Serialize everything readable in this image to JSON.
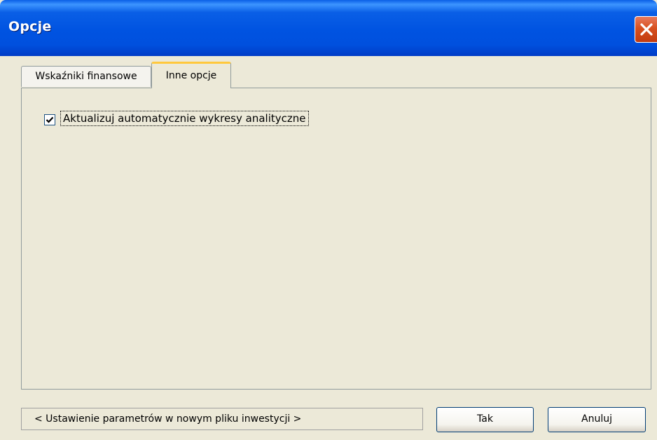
{
  "window": {
    "title": "Opcje"
  },
  "tabs": [
    {
      "label": "Wskaźniki finansowe",
      "selected": false
    },
    {
      "label": "Inne opcje",
      "selected": true
    }
  ],
  "options": {
    "auto_update_label": "Aktualizuj automatycznie wykresy analityczne",
    "auto_update_checked": true
  },
  "footer": {
    "status_text": "< Ustawienie parametrów w nowym pliku inwestycji >",
    "ok_label": "Tak",
    "cancel_label": "Anuluj"
  },
  "colors": {
    "titlebar": "#0053E1",
    "dialog_bg": "#ECE9D8",
    "close_button": "#D7501F",
    "active_tab_accent": "#FFC83C"
  },
  "icons": {
    "close": "close-icon",
    "check": "checkmark-icon"
  }
}
